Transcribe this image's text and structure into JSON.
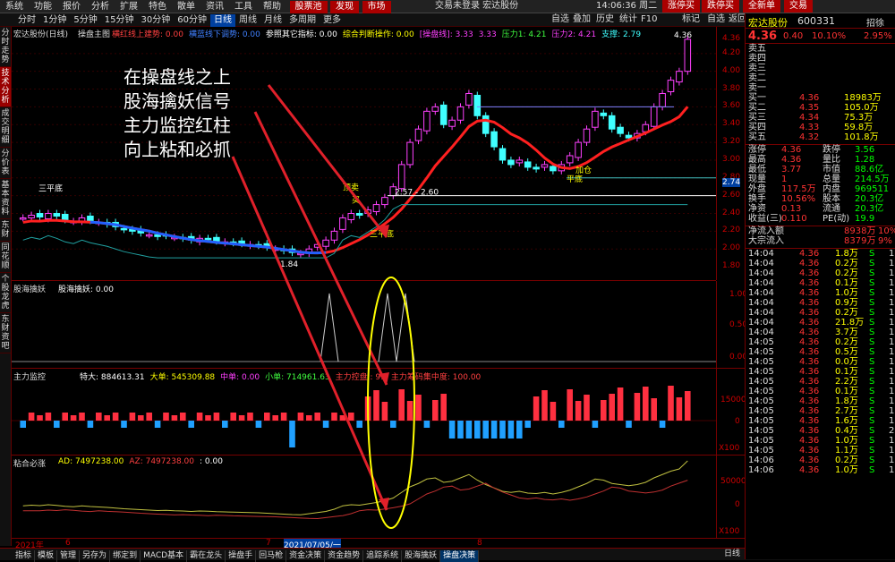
{
  "menubar": {
    "items": [
      "系统",
      "功能",
      "报价",
      "分析",
      "扩展",
      "特色",
      "散单",
      "资讯",
      "工具",
      "帮助"
    ],
    "highlight": [
      "股票池",
      "发现",
      "市场"
    ],
    "center": "交易未登录   宏达股份",
    "time": "14:06:36 周二",
    "right": [
      "涨停买",
      "跌停买",
      "全新单",
      "交易"
    ]
  },
  "toolbar": {
    "periods": [
      "分时",
      "1分钟",
      "5分钟",
      "15分钟",
      "30分钟",
      "60分钟",
      "日线",
      "周线",
      "月线",
      "多周期",
      "更多"
    ],
    "active": "日线",
    "tools": [
      "自选",
      "叠加",
      "历史",
      "统计",
      "F10",
      "标记",
      "自选",
      "返回"
    ]
  },
  "lefttabs": [
    "分时走势",
    "技术分析",
    "成交明细",
    "分价表",
    "基本资料",
    "东财",
    "同花顺",
    "个股龙虎",
    "东财资吧"
  ],
  "main_chart": {
    "title": "宏达股份(日线)",
    "indicator": "操盘主图",
    "items": [
      {
        "text": "横红线上建势: 0.00",
        "color": "#ff4040"
      },
      {
        "text": "横蓝线下调势: 0.00",
        "color": "#4080ff"
      },
      {
        "text": "参照其它指标: 0.00",
        "color": "#ffffff"
      },
      {
        "text": "综合判断操作: 0.00",
        "color": "#ffff00"
      },
      {
        "text": "[操盘线]: 3.33",
        "color": "#ff40ff"
      },
      {
        "text": "3.33",
        "color": "#ff40ff"
      },
      {
        "text": "压力1: 4.21",
        "color": "#40ff40"
      },
      {
        "text": "压力2: 4.21",
        "color": "#ff40ff"
      },
      {
        "text": "支撑: 2.79",
        "color": "#40ffff"
      }
    ],
    "price_axis": [
      "4.36",
      "4.20",
      "4.00",
      "3.80",
      "3.60",
      "3.40",
      "3.20",
      "3.00",
      "2.80",
      "2.74",
      "2.60",
      "2.40",
      "2.20",
      "2.00",
      "1.80"
    ],
    "labels": {
      "high": "4.36",
      "low": "1.84",
      "range": "2.57 - 2.60",
      "buy1": "买",
      "sell1": "卖",
      "l1": "三平底",
      "l2": "顶卖",
      "l3": "平底",
      "l4": "三平底",
      "l5": "加仓"
    }
  },
  "annotation": [
    "在操盘线之上",
    "股海擒妖信号",
    "主力监控红柱",
    "向上粘和必抓"
  ],
  "panel2": {
    "title": "股海擒妖",
    "label": "股海擒妖: 0.00",
    "axis": [
      "1.00",
      "0.50",
      "0.00"
    ]
  },
  "panel3": {
    "title": "主力监控",
    "items": [
      {
        "text": "特大: 884613.31",
        "color": "#ffffff"
      },
      {
        "text": "大单: 545309.88",
        "color": "#ffff00"
      },
      {
        "text": "中单: 0.00",
        "color": "#ff40ff"
      },
      {
        "text": "小单: 714961.63",
        "color": "#40ff40"
      },
      {
        "text": "主力控盘 : 99",
        "color": "#ff4040"
      },
      {
        "text": "主力筹码集中度: 100.00",
        "color": "#ff4040"
      }
    ],
    "axis": [
      "15000",
      "0",
      "X100"
    ]
  },
  "panel4": {
    "title": "粘合必涨",
    "items": [
      {
        "text": "AD: 7497238.00",
        "color": "#ffff00"
      },
      {
        "text": "AZ: 7497238.00",
        "color": "#ff4040"
      },
      {
        "text": ": 0.00",
        "color": "#ffffff"
      }
    ],
    "axis": [
      "50000",
      "0",
      "X100"
    ]
  },
  "timeline": [
    "2021年",
    "6",
    "7",
    "2021/07/05/一",
    "8"
  ],
  "quote": {
    "name": "宏达股份",
    "code": "600331",
    "badge": "招徐",
    "price": "4.36",
    "change": "0.40",
    "pct": "10.10%",
    "pct2": "2.95%",
    "sells": [
      {
        "l": "卖五",
        "p": "",
        "v": ""
      },
      {
        "l": "卖四",
        "p": "",
        "v": ""
      },
      {
        "l": "卖三",
        "p": "",
        "v": ""
      },
      {
        "l": "卖二",
        "p": "",
        "v": ""
      },
      {
        "l": "卖一",
        "p": "",
        "v": ""
      }
    ],
    "buys": [
      {
        "l": "买一",
        "p": "4.36",
        "v": "18983万"
      },
      {
        "l": "买二",
        "p": "4.35",
        "v": "105.0万"
      },
      {
        "l": "买三",
        "p": "4.34",
        "v": "75.3万"
      },
      {
        "l": "买四",
        "p": "4.33",
        "v": "59.8万"
      },
      {
        "l": "买五",
        "p": "4.32",
        "v": "101.8万"
      }
    ],
    "stats": [
      [
        "涨停",
        "4.36",
        "跌停",
        "3.56"
      ],
      [
        "最高",
        "4.36",
        "量比",
        "1.28"
      ],
      [
        "最低",
        "3.77",
        "市值",
        "88.6亿"
      ],
      [
        "现量",
        "1",
        "总量",
        "214.5万"
      ],
      [
        "外盘",
        "117.5万",
        "内盘",
        "969511"
      ],
      [
        "换手",
        "10.56%",
        "股本",
        "20.3亿"
      ],
      [
        "净资",
        "0.13",
        "流通",
        "20.3亿"
      ],
      [
        "收益(三)",
        "0.110",
        "PE(动)",
        "19.9"
      ]
    ],
    "flow": [
      [
        "净流入额",
        "8938万",
        "10%"
      ],
      [
        "大宗流入",
        "8379万",
        "9%"
      ]
    ],
    "ticks": [
      [
        "14:04",
        "4.36",
        "1.8万",
        "S",
        "1"
      ],
      [
        "14:04",
        "4.36",
        "0.2万",
        "S",
        "1"
      ],
      [
        "14:04",
        "4.36",
        "0.2万",
        "S",
        "1"
      ],
      [
        "14:04",
        "4.36",
        "0.1万",
        "S",
        "1"
      ],
      [
        "14:04",
        "4.36",
        "1.0万",
        "S",
        "1"
      ],
      [
        "14:04",
        "4.36",
        "0.9万",
        "S",
        "1"
      ],
      [
        "14:04",
        "4.36",
        "0.2万",
        "S",
        "1"
      ],
      [
        "14:04",
        "4.36",
        "21.8万",
        "S",
        "1"
      ],
      [
        "14:04",
        "4.36",
        "3.7万",
        "S",
        "1"
      ],
      [
        "14:05",
        "4.36",
        "0.2万",
        "S",
        "1"
      ],
      [
        "14:05",
        "4.36",
        "0.5万",
        "S",
        "1"
      ],
      [
        "14:05",
        "4.36",
        "0.0万",
        "S",
        "1"
      ],
      [
        "14:05",
        "4.36",
        "0.1万",
        "S",
        "1"
      ],
      [
        "14:05",
        "4.36",
        "2.2万",
        "S",
        "1"
      ],
      [
        "14:05",
        "4.36",
        "0.1万",
        "S",
        "1"
      ],
      [
        "14:05",
        "4.36",
        "1.8万",
        "S",
        "1"
      ],
      [
        "14:05",
        "4.36",
        "2.7万",
        "S",
        "1"
      ],
      [
        "14:05",
        "4.36",
        "1.6万",
        "S",
        "1"
      ],
      [
        "14:05",
        "4.36",
        "0.4万",
        "S",
        "2"
      ],
      [
        "14:05",
        "4.36",
        "1.0万",
        "S",
        "1"
      ],
      [
        "14:05",
        "4.36",
        "1.1万",
        "S",
        "1"
      ],
      [
        "14:06",
        "4.36",
        "0.2万",
        "S",
        "1"
      ],
      [
        "14:06",
        "4.36",
        "1.0万",
        "S",
        "1"
      ]
    ]
  },
  "bottomtabs": [
    "指标",
    "模板",
    "管理",
    "另存为",
    "绑定到",
    "MACD基本",
    "霸在龙头",
    "操盘手",
    "回马枪",
    "资金决策",
    "资金趋势",
    "追踪系统",
    "股海擒妖",
    "操盘决策"
  ],
  "bottomright": "日线"
}
